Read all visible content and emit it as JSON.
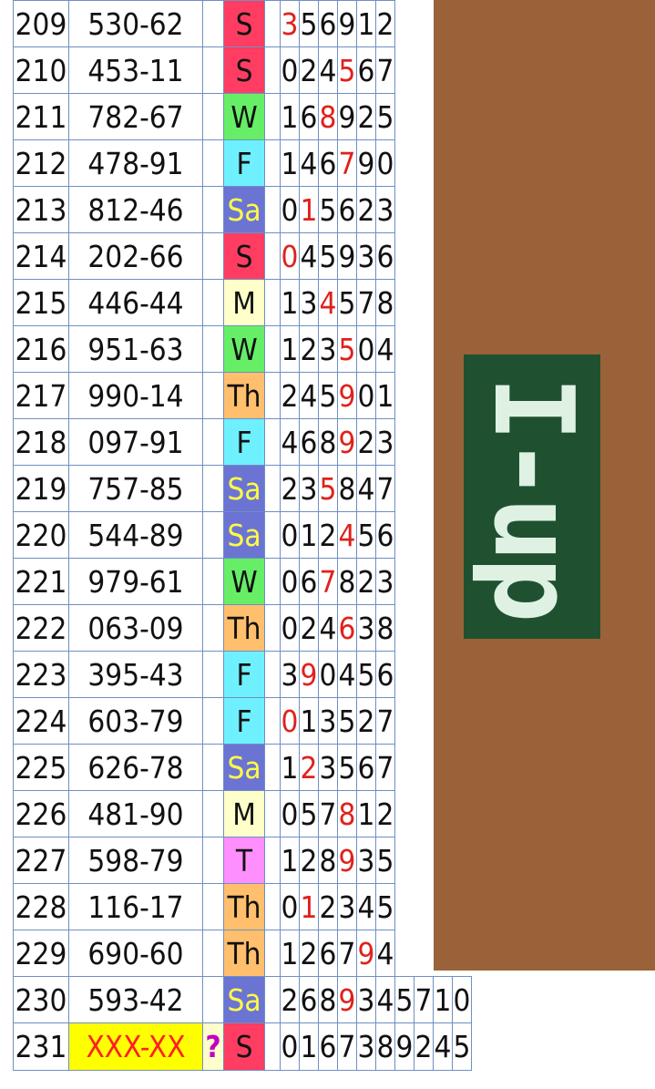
{
  "brand_label": "I-up",
  "rows": [
    {
      "num": "209",
      "result": "530-62",
      "day": "S",
      "digits": [
        "3",
        "5",
        "6",
        "9",
        "1",
        "2"
      ],
      "red": 0
    },
    {
      "num": "210",
      "result": "453-11",
      "day": "S",
      "digits": [
        "0",
        "2",
        "4",
        "5",
        "6",
        "7"
      ],
      "red": 3
    },
    {
      "num": "211",
      "result": "782-67",
      "day": "W",
      "digits": [
        "1",
        "6",
        "8",
        "9",
        "2",
        "5"
      ],
      "red": 2
    },
    {
      "num": "212",
      "result": "478-91",
      "day": "F",
      "digits": [
        "1",
        "4",
        "6",
        "7",
        "9",
        "0"
      ],
      "red": 3
    },
    {
      "num": "213",
      "result": "812-46",
      "day": "Sa",
      "digits": [
        "0",
        "1",
        "5",
        "6",
        "2",
        "3"
      ],
      "red": 1
    },
    {
      "num": "214",
      "result": "202-66",
      "day": "S",
      "digits": [
        "0",
        "4",
        "5",
        "9",
        "3",
        "6"
      ],
      "red": 0
    },
    {
      "num": "215",
      "result": "446-44",
      "day": "M",
      "digits": [
        "1",
        "3",
        "4",
        "5",
        "7",
        "8"
      ],
      "red": 2
    },
    {
      "num": "216",
      "result": "951-63",
      "day": "W",
      "digits": [
        "1",
        "2",
        "3",
        "5",
        "0",
        "4"
      ],
      "red": 3
    },
    {
      "num": "217",
      "result": "990-14",
      "day": "Th",
      "digits": [
        "2",
        "4",
        "5",
        "9",
        "0",
        "1"
      ],
      "red": 3
    },
    {
      "num": "218",
      "result": "097-91",
      "day": "F",
      "digits": [
        "4",
        "6",
        "8",
        "9",
        "2",
        "3"
      ],
      "red": 3
    },
    {
      "num": "219",
      "result": "757-85",
      "day": "Sa",
      "digits": [
        "2",
        "3",
        "5",
        "8",
        "4",
        "7"
      ],
      "red": 2
    },
    {
      "num": "220",
      "result": "544-89",
      "day": "Sa",
      "digits": [
        "0",
        "1",
        "2",
        "4",
        "5",
        "6"
      ],
      "red": 3
    },
    {
      "num": "221",
      "result": "979-61",
      "day": "W",
      "digits": [
        "0",
        "6",
        "7",
        "8",
        "2",
        "3"
      ],
      "red": 2
    },
    {
      "num": "222",
      "result": "063-09",
      "day": "Th",
      "digits": [
        "0",
        "2",
        "4",
        "6",
        "3",
        "8"
      ],
      "red": 3
    },
    {
      "num": "223",
      "result": "395-43",
      "day": "F",
      "digits": [
        "3",
        "9",
        "0",
        "4",
        "5",
        "6"
      ],
      "red": 1
    },
    {
      "num": "224",
      "result": "603-79",
      "day": "F",
      "digits": [
        "0",
        "1",
        "3",
        "5",
        "2",
        "7"
      ],
      "red": 0
    },
    {
      "num": "225",
      "result": "626-78",
      "day": "Sa",
      "digits": [
        "1",
        "2",
        "3",
        "5",
        "6",
        "7"
      ],
      "red": 1
    },
    {
      "num": "226",
      "result": "481-90",
      "day": "M",
      "digits": [
        "0",
        "5",
        "7",
        "8",
        "1",
        "2"
      ],
      "red": 3
    },
    {
      "num": "227",
      "result": "598-79",
      "day": "T",
      "digits": [
        "1",
        "2",
        "8",
        "9",
        "3",
        "5"
      ],
      "red": 3
    },
    {
      "num": "228",
      "result": "116-17",
      "day": "Th",
      "digits": [
        "0",
        "1",
        "2",
        "3",
        "4",
        "5"
      ],
      "red": 1
    },
    {
      "num": "229",
      "result": "690-60",
      "day": "Th",
      "digits": [
        "1",
        "2",
        "6",
        "7",
        "9",
        "4"
      ],
      "red": 4
    },
    {
      "num": "230",
      "result": "593-42",
      "day": "Sa",
      "digits": [
        "2",
        "6",
        "8",
        "9",
        "3",
        "4",
        "5",
        "7",
        "1",
        "0"
      ],
      "red": 3
    },
    {
      "num": "231",
      "result": "XXX-XX",
      "question": "?",
      "day": "S",
      "digits": [
        "0",
        "1",
        "6",
        "7",
        "3",
        "8",
        "9",
        "2",
        "4",
        "5"
      ],
      "red": -1
    }
  ],
  "colors": {
    "red_digit": "#e0211c",
    "grid_line": "#6e8fc4",
    "brown_panel": "#9a6238",
    "brand_panel": "#1f5130",
    "brand_text": "#dff1e3",
    "pending_result_bg": "#ffff00",
    "day_colors": {
      "S": "#ff3d62",
      "W": "#66ee66",
      "F": "#6ff0ff",
      "Sa": "#6b74d3",
      "M": "#ffffc9",
      "Th": "#ffbf6d",
      "T": "#ff8eff"
    }
  }
}
